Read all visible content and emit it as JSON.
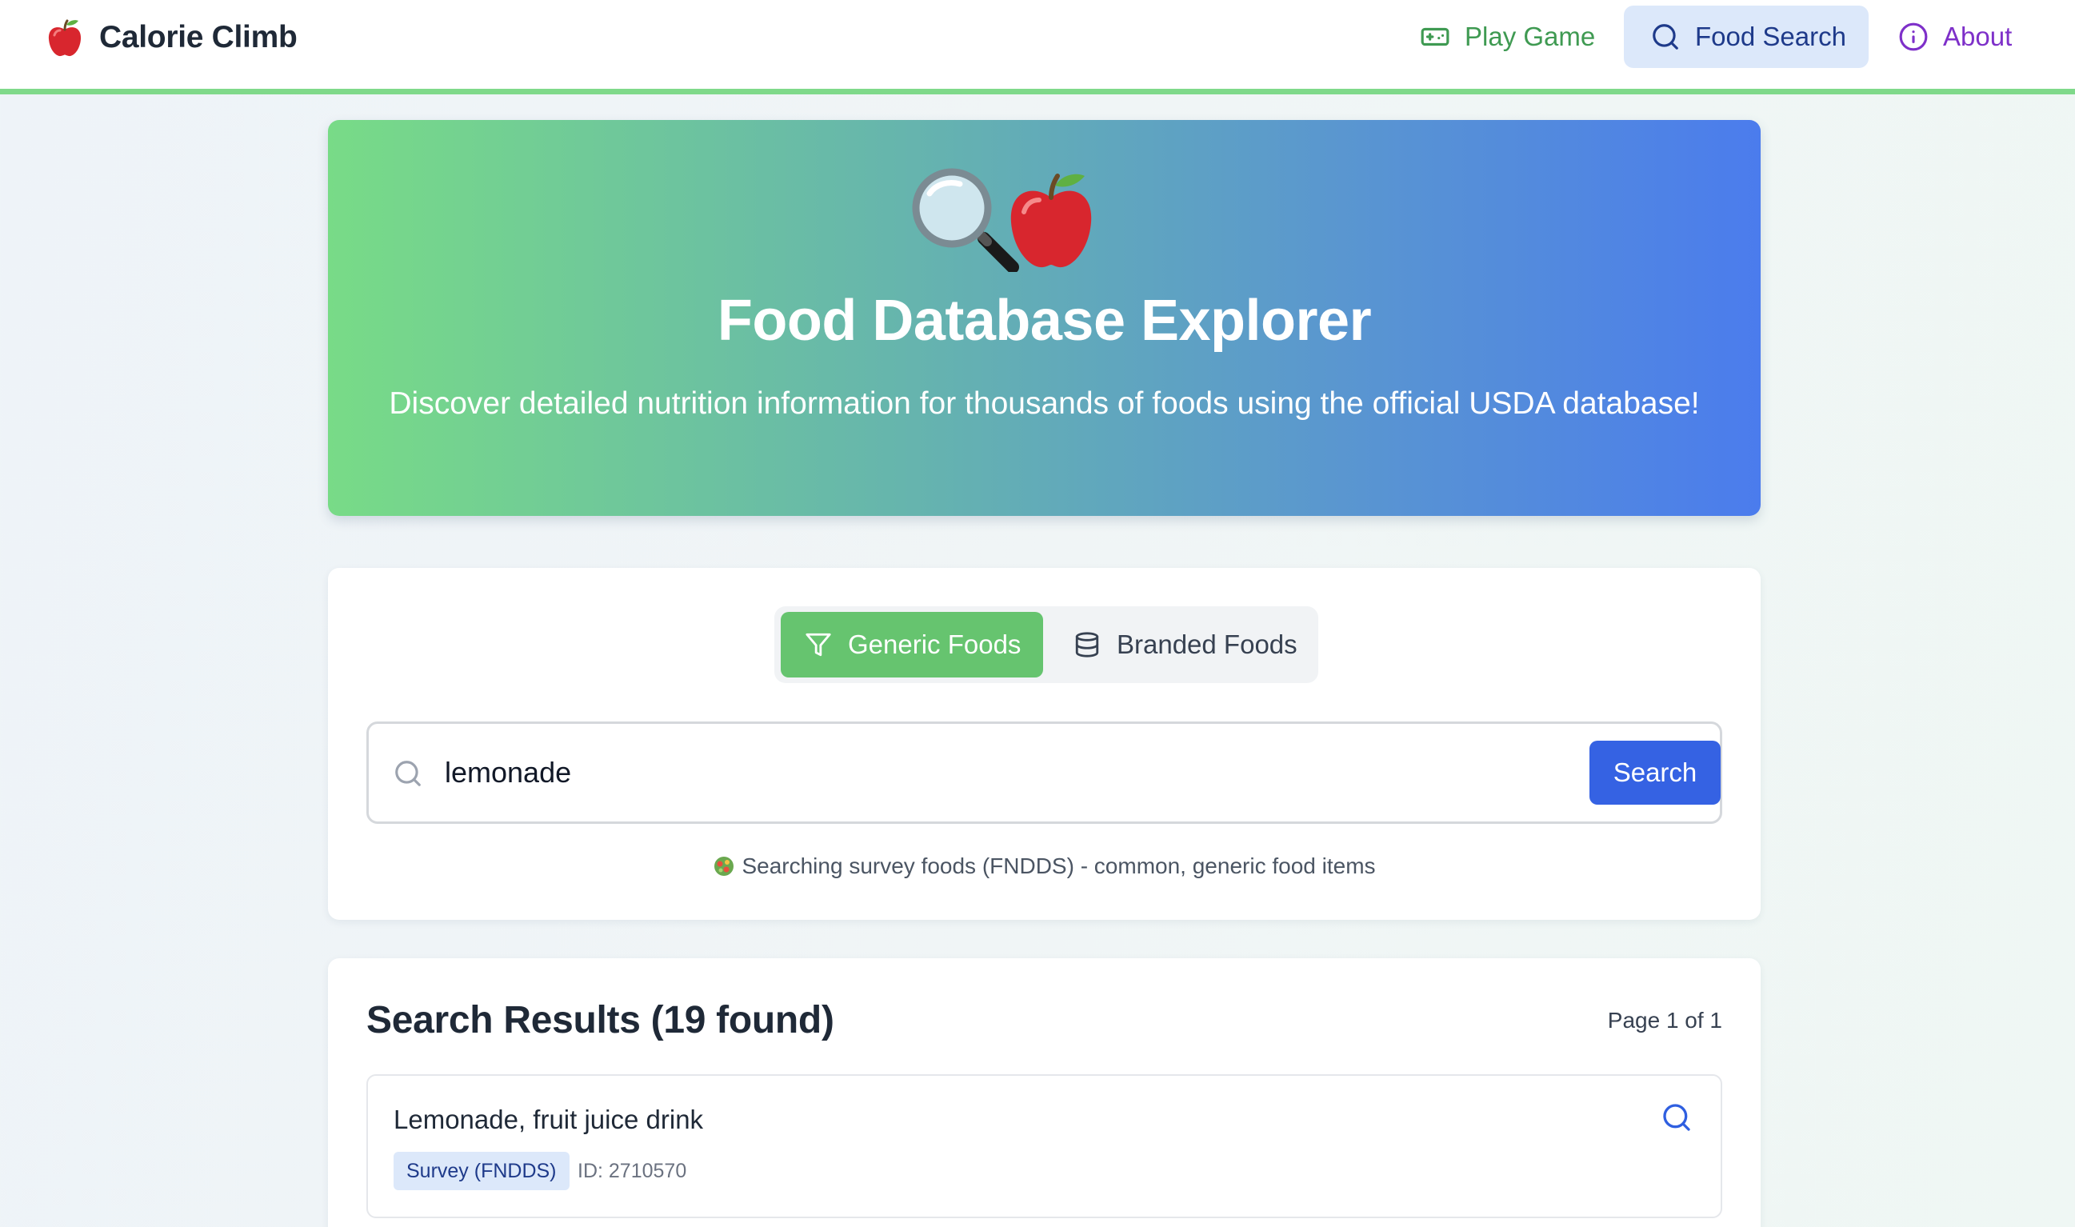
{
  "navbar": {
    "brand": {
      "name": "Calorie Climb",
      "logo_icon": "apple-icon"
    },
    "items": [
      {
        "label": "Play Game",
        "icon": "gamepad-icon",
        "color": "#3f9a52",
        "active": false
      },
      {
        "label": "Food Search",
        "icon": "search-icon",
        "color": "#1e3a8a",
        "active": true
      },
      {
        "label": "About",
        "icon": "info-icon",
        "color": "#7e30c9",
        "active": false
      }
    ],
    "accent_color": "#7fd98a"
  },
  "hero": {
    "icons": [
      "magnifying-glass-icon",
      "apple-icon"
    ],
    "title": "Food Database Explorer",
    "subtitle": "Discover detailed nutrition information for thousands of foods using the official USDA database!",
    "gradient": [
      "#78db87",
      "#4b7ced"
    ]
  },
  "search": {
    "toggle": [
      {
        "label": "Generic Foods",
        "icon": "filter-icon",
        "active": true
      },
      {
        "label": "Branded Foods",
        "icon": "database-icon",
        "active": false
      }
    ],
    "query": "lemonade",
    "button_label": "Search",
    "hint": "Searching survey foods (FNDDS) - common, generic food items",
    "hint_icon": "salad-icon",
    "active_color": "#66c46f",
    "button_color": "#3562e3"
  },
  "results": {
    "title": "Search Results (19 found)",
    "page_label": "Page 1 of 1",
    "items": [
      {
        "name": "Lemonade, fruit juice drink",
        "badge": "Survey (FNDDS)",
        "id_label": "ID: 2710570",
        "action_icon": "search-icon"
      }
    ]
  }
}
